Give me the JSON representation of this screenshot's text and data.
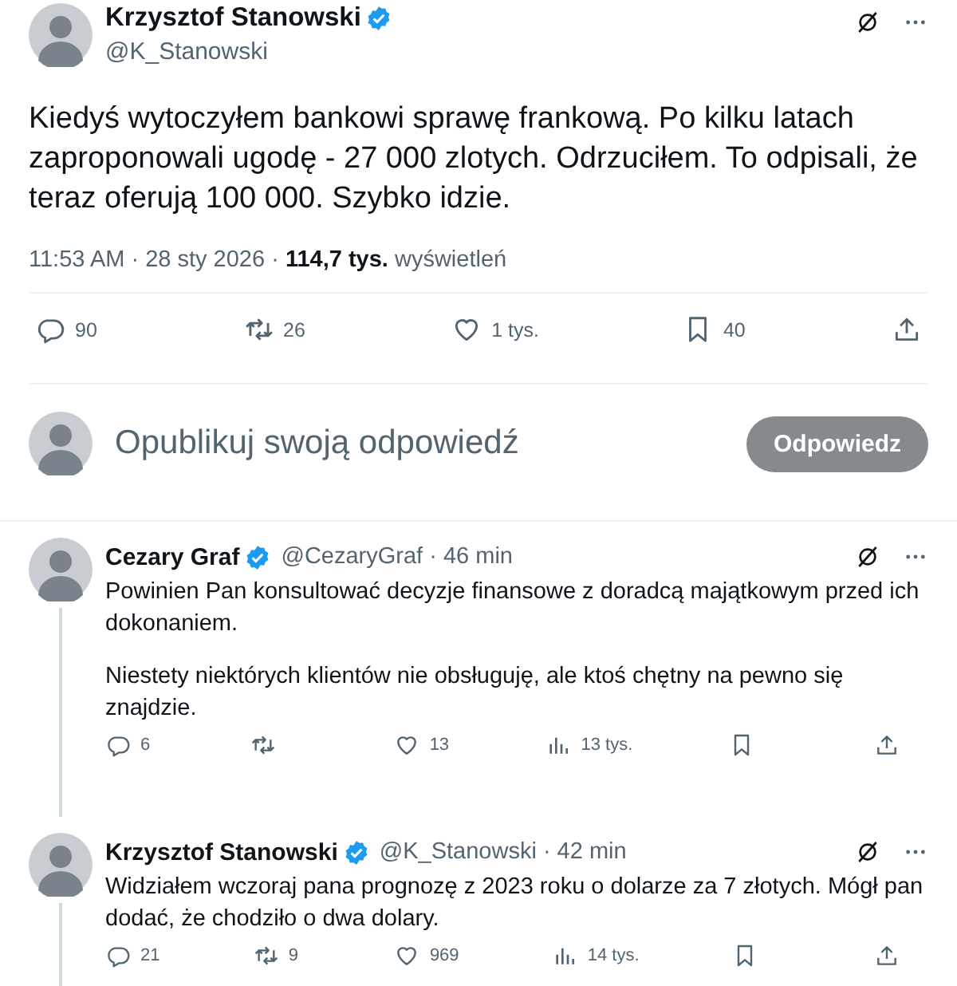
{
  "tweet": {
    "author": {
      "name": "Krzysztof Stanowski",
      "handle": "@K_Stanowski",
      "verified": true
    },
    "text": "Kiedyś wytoczyłem bankowi sprawę frankową. Po kilku latach zaproponowali ugodę - 27 000 zlotych. Odrzuciłem. To odpisali, że teraz oferują 100 000. Szybko idzie.",
    "meta": "11:53 AM · 28 sty 2026 · **114,7 tys.** wyświetleń",
    "actions": [
      {
        "kind": "reply",
        "count": "90"
      },
      {
        "kind": "retweet",
        "count": "26"
      },
      {
        "kind": "like",
        "count": "1 tys."
      },
      {
        "kind": "bookmark",
        "count": "40"
      },
      {
        "kind": "share"
      }
    ]
  },
  "composer": {
    "placeholder": "Opublikuj swoją odpowiedź",
    "button": "Odpowiedz"
  },
  "replies": [
    {
      "author": {
        "name": "Cezary Graf",
        "handle": "@CezaryGraf · 46 min",
        "verified": true
      },
      "paragraphs": [
        "Powinien Pan konsultować decyzje finansowe z doradcą majątkowym przed ich dokonaniem.",
        "Niestety niektórych klientów nie obsługuję, ale ktoś chętny na pewno się znajdzie."
      ],
      "actions": [
        {
          "kind": "reply",
          "count": "6"
        },
        {
          "kind": "retweet"
        },
        {
          "kind": "like",
          "count": "13"
        },
        {
          "kind": "views",
          "count": "13 tys."
        },
        {
          "kind": "bookmark"
        },
        {
          "kind": "share"
        }
      ]
    },
    {
      "author": {
        "name": "Krzysztof Stanowski",
        "handle": "@K_Stanowski · 42 min",
        "verified": true
      },
      "paragraphs": [
        "Widziałem wczoraj pana prognozę z 2023 roku o dolarze za 7 złotych. Mógł pan dodać, że chodziło o dwa dolary."
      ],
      "actions": [
        {
          "kind": "reply",
          "count": "21"
        },
        {
          "kind": "retweet",
          "count": "9"
        },
        {
          "kind": "like",
          "count": "969"
        },
        {
          "kind": "views",
          "count": "14 tys."
        },
        {
          "kind": "bookmark"
        },
        {
          "kind": "share"
        }
      ]
    }
  ]
}
